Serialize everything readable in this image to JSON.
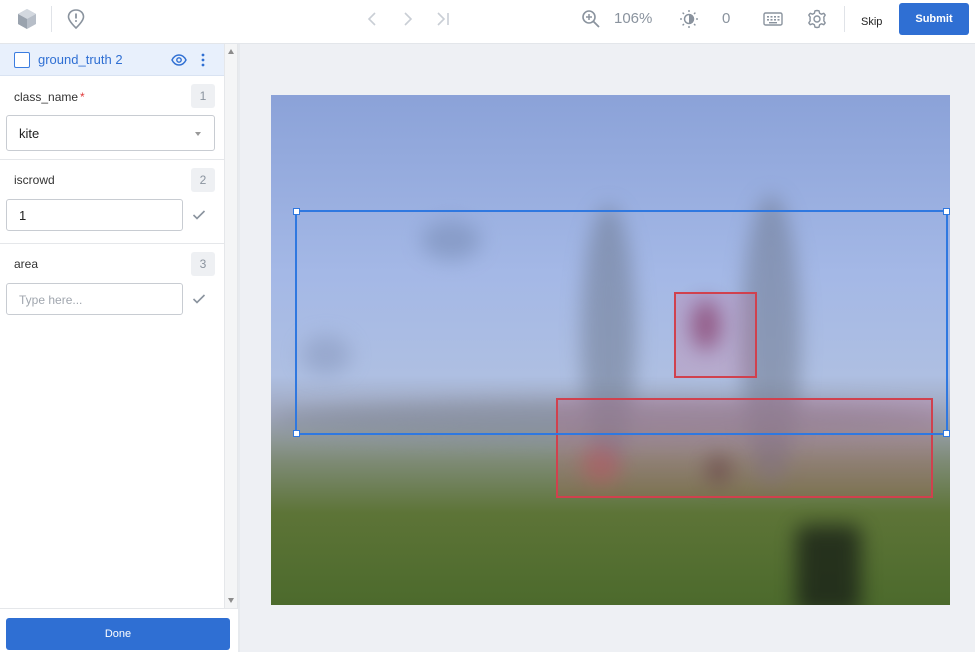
{
  "topbar": {
    "zoom": "106%",
    "brightness": "0",
    "skip_label": "Skip",
    "submit_label": "Submit",
    "icons": [
      "app-logo-icon",
      "issue-icon",
      "back-icon",
      "forward-icon",
      "last-icon",
      "zoom-in-icon",
      "brightness-icon",
      "keyboard-icon",
      "settings-icon"
    ]
  },
  "sidebar": {
    "object_label": "ground_truth 2",
    "attributes": [
      {
        "name": "class_name",
        "number": "1",
        "required": "*",
        "value": "kite"
      },
      {
        "name": "iscrowd",
        "number": "2",
        "value": "1"
      },
      {
        "name": "area",
        "number": "3",
        "placeholder": "Type here..."
      }
    ],
    "done_label": "Done"
  },
  "colors": {
    "accent": "#2f6fd3",
    "selected_box": "#2f78e0",
    "other_box": "#d0414e"
  }
}
